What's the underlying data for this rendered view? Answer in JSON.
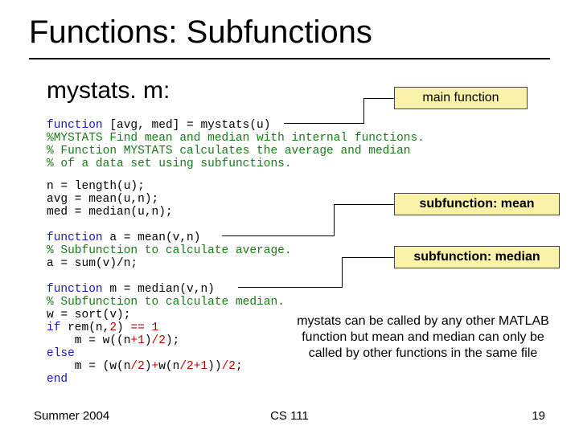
{
  "title": "Functions: Subfunctions",
  "subtitle": "mystats. m:",
  "labels": {
    "main": "main function",
    "mean": "subfunction: mean",
    "median": "subfunction: median"
  },
  "code": {
    "block1": {
      "l1a": "function",
      "l1b": " [avg, med] = mystats(u)",
      "l2": "%MYSTATS Find mean and median with internal functions.",
      "l3": "% Function MYSTATS calculates the average and median",
      "l4": "% of a data set using subfunctions."
    },
    "block2": {
      "l1": "n = length(u);",
      "l2": "avg = mean(u,n);",
      "l3": "med = median(u,n);"
    },
    "block3": {
      "l1a": "function",
      "l1b": " a = mean(v,n)",
      "l2": "% Subfunction to calculate average.",
      "l3": "a = sum(v)/n;"
    },
    "block4": {
      "l1a": "function",
      "l1b": " m = median(v,n)",
      "l2": "% Subfunction to calculate median.",
      "l3": "w = sort(v);",
      "l4a": "if",
      "l4b": " rem(n,",
      "l4c": "2",
      "l4d": ") ",
      "l4e": "== 1",
      "l5a": "    m = w((n",
      "l5b": "+1",
      "l5c": ")",
      "l5d": "/2",
      "l5e": ");",
      "l6": "else",
      "l7a": "    m = (w(n",
      "l7b": "/2",
      "l7c": ")",
      "l7d": "+",
      "l7e": "w(n",
      "l7f": "/2+1",
      "l7g": "))",
      "l7h": "/2",
      "l7i": ";",
      "l8": "end"
    }
  },
  "note": "mystats can be called by any other MATLAB function but mean and median can only be called by other functions in the same file",
  "footer": {
    "left": "Summer 2004",
    "center": "CS 111",
    "right": "19"
  }
}
